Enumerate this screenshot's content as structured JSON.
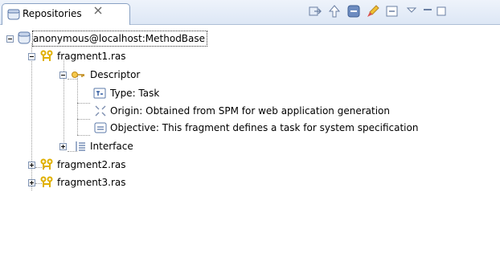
{
  "view": {
    "tab_title": "Repositories",
    "tab_icon": "repository-icon",
    "close_icon": "close-icon",
    "toolbar_icons": [
      "import-icon",
      "up-arrow-icon",
      "collapse-all-icon",
      "brush-icon",
      "minimize-icon",
      "view-menu-icon",
      "restore-icon",
      "maximize-icon"
    ]
  },
  "tree": {
    "root": {
      "label": "anonymous@localhost:MethodBase",
      "icon": "repository-icon",
      "expanded": true
    },
    "fragment1": {
      "label": "fragment1.ras",
      "icon": "fragment-icon",
      "expanded": true
    },
    "descriptor": {
      "label": "Descriptor",
      "icon": "key-icon",
      "expanded": true
    },
    "type": {
      "label": "Type: Task",
      "icon": "type-icon"
    },
    "origin": {
      "label": "Origin: Obtained from SPM for web application generation",
      "icon": "origin-icon"
    },
    "objective": {
      "label": "Objective: This fragment defines a task for system specification",
      "icon": "objective-icon"
    },
    "interface": {
      "label": "Interface",
      "icon": "interface-icon",
      "expanded": false
    },
    "fragment2": {
      "label": "fragment2.ras",
      "icon": "fragment-icon",
      "expanded": false
    },
    "fragment3": {
      "label": "fragment3.ras",
      "icon": "fragment-icon",
      "expanded": false
    }
  },
  "colors": {
    "accent": "#8aa2c4",
    "fragment": "#e0b000",
    "selection_outline": "#333333"
  }
}
